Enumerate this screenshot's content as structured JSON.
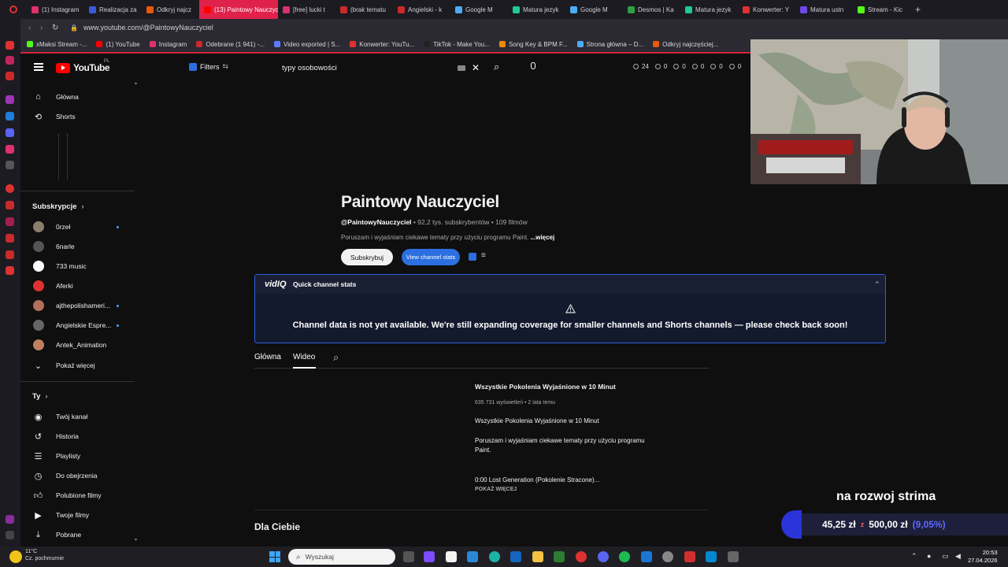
{
  "browser": {
    "tabs": [
      {
        "label": "(1) Instagram",
        "color": "#e1306c"
      },
      {
        "label": "Realizacja za",
        "color": "#3b5bdb"
      },
      {
        "label": "Odkryj najcz",
        "color": "#e8590c"
      },
      {
        "label": "(13) Paintowy Nauczyciel",
        "color": "#ff0000",
        "active": true
      },
      {
        "label": "[free] lucki t",
        "color": "#d6336c"
      },
      {
        "label": "(brak tematu",
        "color": "#c92a2a"
      },
      {
        "label": "Angielski - k",
        "color": "#c92a2a"
      },
      {
        "label": "Google M",
        "color": "#4dabf7"
      },
      {
        "label": "Matura jezyk",
        "color": "#20c997"
      },
      {
        "label": "Google M",
        "color": "#4dabf7"
      },
      {
        "label": "Desmos | Ka",
        "color": "#2f9e44"
      },
      {
        "label": "Matura jezyk",
        "color": "#20c997"
      },
      {
        "label": "Konwerter: Y",
        "color": "#e03131"
      },
      {
        "label": "Matura ustn",
        "color": "#7048e8"
      },
      {
        "label": "Stream - Kic",
        "color": "#53fc18"
      }
    ],
    "url": "www.youtube.com/@PaintowyNauczyciel",
    "bookmarks": [
      {
        "label": "xMaksi Stream -...",
        "color": "#53fc18"
      },
      {
        "label": "(1) YouTube",
        "color": "#ff0000"
      },
      {
        "label": "Instagram",
        "color": "#e1306c"
      },
      {
        "label": "Odebrane (1 941) -...",
        "color": "#c92a2a"
      },
      {
        "label": "Video exported | S...",
        "color": "#5c7cfa"
      },
      {
        "label": "Konwerter: YouTu...",
        "color": "#e03131"
      },
      {
        "label": "TikTok - Make You...",
        "color": "#222222"
      },
      {
        "label": "Song Key & BPM F...",
        "color": "#f08c00"
      },
      {
        "label": "Strona główna – D...",
        "color": "#4dabf7"
      },
      {
        "label": "Odkryj najczęściej...",
        "color": "#e8590c"
      }
    ]
  },
  "header": {
    "logo": "YouTube",
    "logo_region": "PL",
    "filters_label": "Filters",
    "search_value": "typy osobowości",
    "stats": [
      "24",
      "0",
      "0",
      "0",
      "0",
      "0"
    ]
  },
  "nav": {
    "main": [
      {
        "label": "Główna",
        "icon": "home-icon"
      },
      {
        "label": "Shorts",
        "icon": "shorts-icon"
      }
    ],
    "subs_heading": "Subskrypcje",
    "subs": [
      {
        "label": "0rzeł",
        "color": "#8a7f6a",
        "dot": true
      },
      {
        "label": "6narle",
        "color": "#555555",
        "dot": false
      },
      {
        "label": "733 music",
        "color": "#ffffff",
        "dot": false
      },
      {
        "label": "Aferki",
        "color": "#e03131",
        "dot": false
      },
      {
        "label": "ajthepolishameri...",
        "color": "#b26f5a",
        "dot": true
      },
      {
        "label": "Angielskie Espre...",
        "color": "#666666",
        "dot": true
      },
      {
        "label": "Antek_Animation",
        "color": "#c08060",
        "dot": false
      }
    ],
    "show_more": "Pokaż więcej",
    "you_heading": "Ty",
    "you": [
      {
        "label": "Twój kanał",
        "icon": "channel-icon"
      },
      {
        "label": "Historia",
        "icon": "history-icon"
      },
      {
        "label": "Playlisty",
        "icon": "playlist-icon"
      },
      {
        "label": "Do obejrzenia",
        "icon": "clock-icon"
      },
      {
        "label": "Polubione filmy",
        "icon": "like-icon"
      },
      {
        "label": "Twoje filmy",
        "icon": "video-icon"
      },
      {
        "label": "Pobrane",
        "icon": "download-icon"
      }
    ]
  },
  "channel": {
    "title": "Paintowy Nauczyciel",
    "handle": "@PaintowyNauczyciel",
    "meta": " • 92,2 tys. subskrybentów • 109 filmów",
    "description": "Poruszam i wyjaśniam ciekawe tematy przy użyciu programu Paint.",
    "more": "...więcej",
    "subscribe": "Subskrybuj",
    "view_stats": "View channel stats"
  },
  "vidiq": {
    "brand": "vidIQ",
    "title": "Quick channel stats",
    "message": "Channel data is not yet available. We're still expanding coverage for smaller channels and Shorts channels — please check back soon!"
  },
  "tabs": [
    "Główna",
    "Wideo"
  ],
  "featured": {
    "title": "Wszystkie Pokolenia Wyjaśnione w 10 Minut",
    "meta": "635 731 wyświetleń • 2 lata temu",
    "subtitle": "Wszystkie Pokolenia Wyjaśnione w 10 Minut",
    "desc1": "Poruszam i wyjaśniam ciekawe tematy przy użyciu programu",
    "desc2": "Paint.",
    "chapter": "0:00 Lost Generation (Pokolenie Stracone)...",
    "show_more": "POKAŻ WIĘCEJ"
  },
  "section_title": "Dla Ciebie",
  "overlay": {
    "title": "na rozwoj strima",
    "current": "45,25 zł",
    "sep": "z",
    "goal": "500,00 zł",
    "pct": "(9,05%)"
  },
  "taskbar": {
    "temp": "11°C",
    "weather": "Cz. pochmurnie",
    "search_placeholder": "Wyszukaj",
    "time": "20:53",
    "date": "27.04.2026"
  }
}
